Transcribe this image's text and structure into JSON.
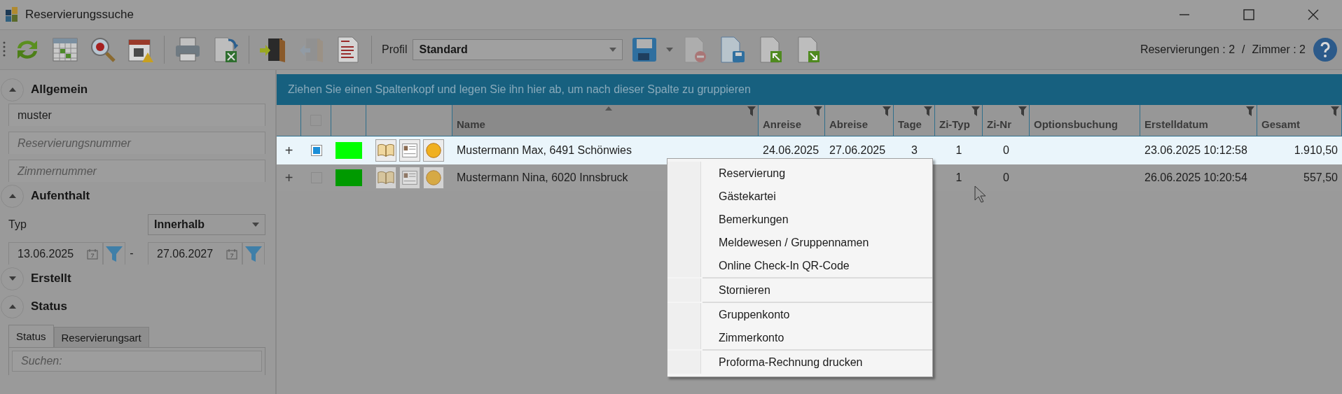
{
  "window": {
    "title": "Reservierungssuche"
  },
  "toolbar": {
    "buttons": [
      {
        "kind": "refresh",
        "disabled": false
      },
      {
        "kind": "calendar-grid",
        "disabled": false
      },
      {
        "kind": "magnifier",
        "disabled": false
      },
      {
        "kind": "calendar-warning",
        "disabled": false
      },
      {
        "kind": "separator"
      },
      {
        "kind": "printer",
        "disabled": false
      },
      {
        "kind": "sheet-export",
        "disabled": false
      },
      {
        "kind": "separator"
      },
      {
        "kind": "door-in",
        "disabled": false
      },
      {
        "kind": "door-out",
        "disabled": true
      },
      {
        "kind": "report",
        "disabled": false
      },
      {
        "kind": "separator"
      }
    ],
    "profile": {
      "label": "Profil",
      "value": "Standard"
    },
    "profile_buttons": [
      {
        "kind": "floppy-menu",
        "disabled": false
      },
      {
        "kind": "doc-remove",
        "disabled": true
      },
      {
        "kind": "doc-save",
        "disabled": false
      },
      {
        "kind": "doc-up",
        "disabled": false
      },
      {
        "kind": "doc-down",
        "disabled": false
      }
    ],
    "counts": {
      "reservations": "Reservierungen : 2",
      "divider": "/",
      "rooms": "Zimmer : 2"
    }
  },
  "sidebar": {
    "sections": [
      {
        "kind": "fields",
        "title": "Allgemein",
        "expanded": true,
        "fields": [
          {
            "value": "muster"
          },
          {
            "placeholder": "Reservierungsnummer"
          },
          {
            "placeholder": "Zimmernummer"
          }
        ]
      },
      {
        "kind": "range",
        "title": "Aufenthalt",
        "expanded": true,
        "type_label": "Typ",
        "type_value": "Innerhalb",
        "from": "13.06.2025",
        "dash": "-",
        "to": "27.06.2027"
      },
      {
        "kind": "empty",
        "title": "Erstellt",
        "expanded": false
      },
      {
        "kind": "filter-tabs",
        "title": "Status",
        "expanded": true,
        "tabs": [
          {
            "label": "Status",
            "selected": true
          },
          {
            "label": "Reservierungsart",
            "selected": false
          }
        ],
        "search_placeholder": "Suchen:"
      }
    ]
  },
  "grid": {
    "group_hint": "Ziehen Sie einen Spaltenkopf und legen Sie ihn hier ab, um nach dieser Spalte zu gruppieren",
    "header_checked": false,
    "columns": [
      {
        "label": "Name",
        "filter": true,
        "sorted": true
      },
      {
        "label": "Anreise",
        "filter": true,
        "sorted": false
      },
      {
        "label": "Abreise",
        "filter": true,
        "sorted": false
      },
      {
        "label": "Tage",
        "filter": true,
        "sorted": false
      },
      {
        "label": "Zi-Typ",
        "filter": true,
        "sorted": false
      },
      {
        "label": "Zi-Nr",
        "filter": true,
        "sorted": false
      },
      {
        "label": "Optionsbuchung",
        "filter": false,
        "sorted": false
      },
      {
        "label": "Erstelldatum",
        "filter": true,
        "sorted": false
      },
      {
        "label": "Gesamt",
        "filter": true,
        "sorted": false
      }
    ],
    "rows": [
      {
        "selected": true,
        "expand": "+",
        "checked": true,
        "color": "#00ff00",
        "cells": [
          "Mustermann Max, 6491 Schönwies",
          "24.06.2025",
          "27.06.2025",
          "3",
          "1",
          "0",
          null,
          "23.06.2025 10:12:58",
          "1.910,50"
        ]
      },
      {
        "selected": false,
        "expand": "+",
        "checked": false,
        "color": "#009a00",
        "cells": [
          "Mustermann Nina, 6020 Innsbruck",
          null,
          null,
          null,
          "1",
          "0",
          null,
          "26.06.2025 10:20:54",
          "557,50"
        ]
      }
    ]
  },
  "context_menu": {
    "groups": [
      {
        "items": [
          "Reservierung",
          "Gästekartei",
          "Bemerkungen",
          "Meldewesen / Gruppennamen",
          "Online Check-In QR-Code"
        ]
      },
      {
        "items": [
          "Stornieren"
        ]
      },
      {
        "items": [
          "Gruppenkonto",
          "Zimmerkonto"
        ]
      },
      {
        "items": [
          "Proforma-Rechnung drucken"
        ]
      }
    ]
  }
}
